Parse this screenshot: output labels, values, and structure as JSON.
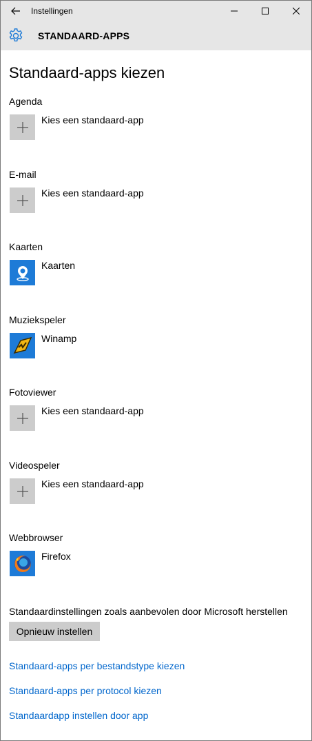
{
  "window": {
    "title": "Instellingen"
  },
  "header": {
    "title": "STANDAARD-APPS"
  },
  "page_title": "Standaard-apps kiezen",
  "sections": [
    {
      "label": "Agenda",
      "app": "Kies een standaard-app",
      "icon": "plus-icon"
    },
    {
      "label": "E-mail",
      "app": "Kies een standaard-app",
      "icon": "plus-icon"
    },
    {
      "label": "Kaarten",
      "app": "Kaarten",
      "icon": "maps-icon"
    },
    {
      "label": "Muziekspeler",
      "app": "Winamp",
      "icon": "winamp-icon"
    },
    {
      "label": "Fotoviewer",
      "app": "Kies een standaard-app",
      "icon": "plus-icon"
    },
    {
      "label": "Videospeler",
      "app": "Kies een standaard-app",
      "icon": "plus-icon"
    },
    {
      "label": "Webbrowser",
      "app": "Firefox",
      "icon": "firefox-icon"
    }
  ],
  "reset": {
    "text": "Standaardinstellingen zoals aanbevolen door Microsoft herstellen",
    "button": "Opnieuw instellen"
  },
  "links": [
    "Standaard-apps per bestandstype kiezen",
    "Standaard-apps per protocol kiezen",
    "Standaardapp instellen door app"
  ],
  "colors": {
    "accent": "#0066cc",
    "titlebar": "#e6e6e6",
    "tile_gray": "#cccccc",
    "tile_blue": "#1e7bd7"
  }
}
